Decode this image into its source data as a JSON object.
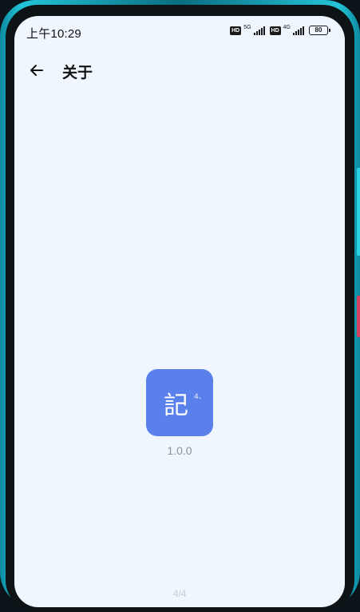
{
  "status_bar": {
    "time": "上午10:29",
    "hd_label": "HD",
    "sim1_network": "5G",
    "sim2_network": "4G",
    "battery": "80"
  },
  "app_bar": {
    "back_icon": "arrow-left-icon",
    "title": "关于"
  },
  "about": {
    "logo_char": "記",
    "logo_mark": "4、",
    "version": "1.0.0",
    "footer": "4/4"
  },
  "colors": {
    "background": "#f0f6fd",
    "logo_bg": "#5a80ec",
    "device_frame": "#23c4d8"
  }
}
